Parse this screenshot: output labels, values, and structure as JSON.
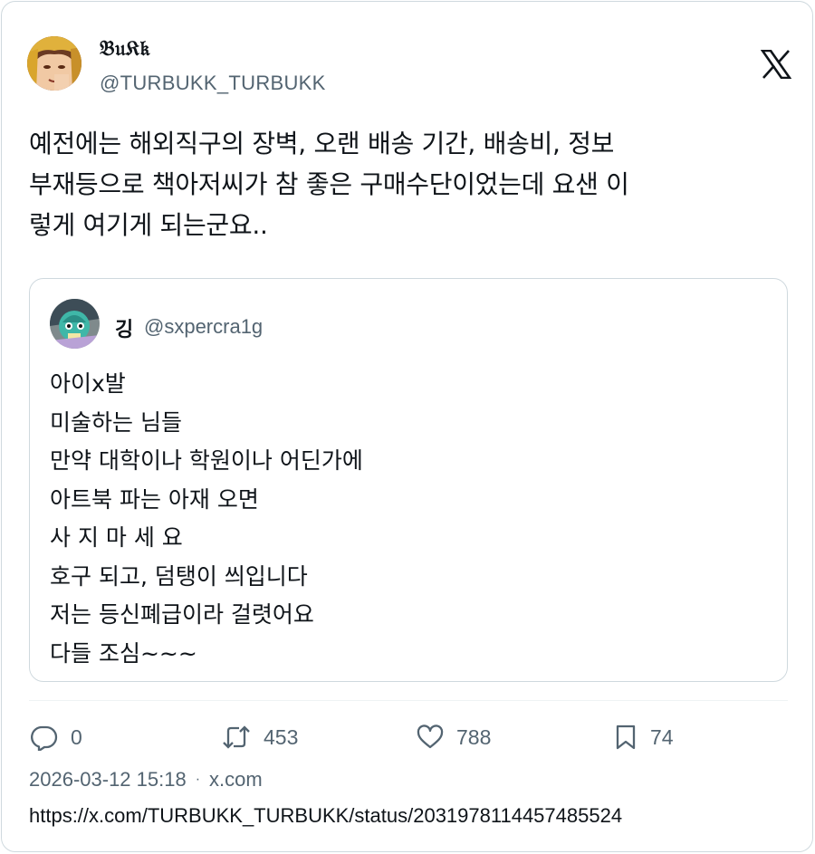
{
  "tweet": {
    "author_name": "𝔅𝔲𝔎𝔨",
    "author_handle": "@TURBUKK_TURBUKK",
    "text": "예전에는 해외직구의 장벽, 오랜 배송 기간, 배송비, 정보\n부재등으로 책아저씨가 참 좋은 구매수단이었는데 요샌 이\n렇게 여기게 되는군요..",
    "logo_icon": "x-logo-icon"
  },
  "quote": {
    "author_name": "깅",
    "author_handle": "@sxpercra1g",
    "text": "아이x발\n미술하는 님들\n만약 대학이나 학원이나 어딘가에\n아트북 파는 아재 오면\n사 지 마 세 요\n호구 되고, 덤탱이 씌입니다\n저는 등신폐급이라 걸렷어요\n다들 조심~~~"
  },
  "actions": {
    "reply_count": "0",
    "retweet_count": "453",
    "like_count": "788",
    "bookmark_count": "74"
  },
  "meta": {
    "timestamp": "2026-03-12 15:18",
    "separator": "·",
    "source": "x.com",
    "url": "https://x.com/TURBUKK_TURBUKK/status/2031978114457485524"
  },
  "colors": {
    "text": "#0f1419",
    "secondary": "#536471",
    "border": "#cfd9de"
  }
}
